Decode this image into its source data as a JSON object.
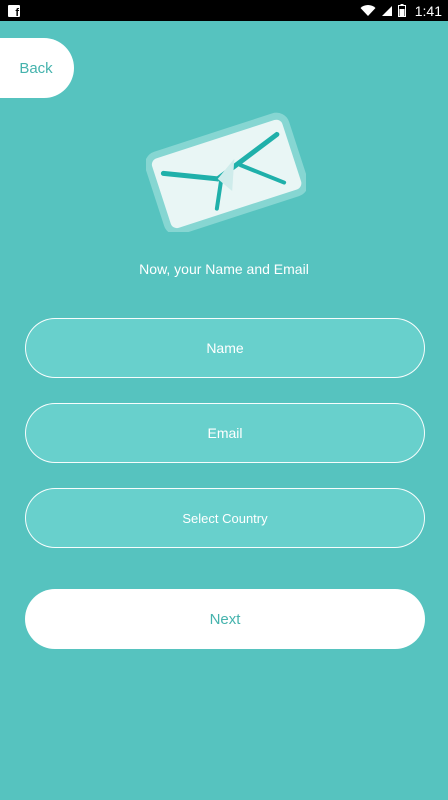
{
  "status_bar": {
    "time": "1:41",
    "icons": [
      "facebook-icon",
      "wifi-icon",
      "signal-icon",
      "battery-icon"
    ]
  },
  "nav": {
    "back_label": "Back"
  },
  "headline": "Now, your Name and Email",
  "form": {
    "name_placeholder": "Name",
    "email_placeholder": "Email",
    "country_label": "Select Country"
  },
  "next_label": "Next",
  "colors": {
    "background": "#56c3bf",
    "field_fill": "#68d0cc",
    "accent_text": "#45b3ad",
    "envelope_fill": "#e9f6f5",
    "envelope_border": "#86d6d2",
    "envelope_lines": "#1fb0aa"
  }
}
